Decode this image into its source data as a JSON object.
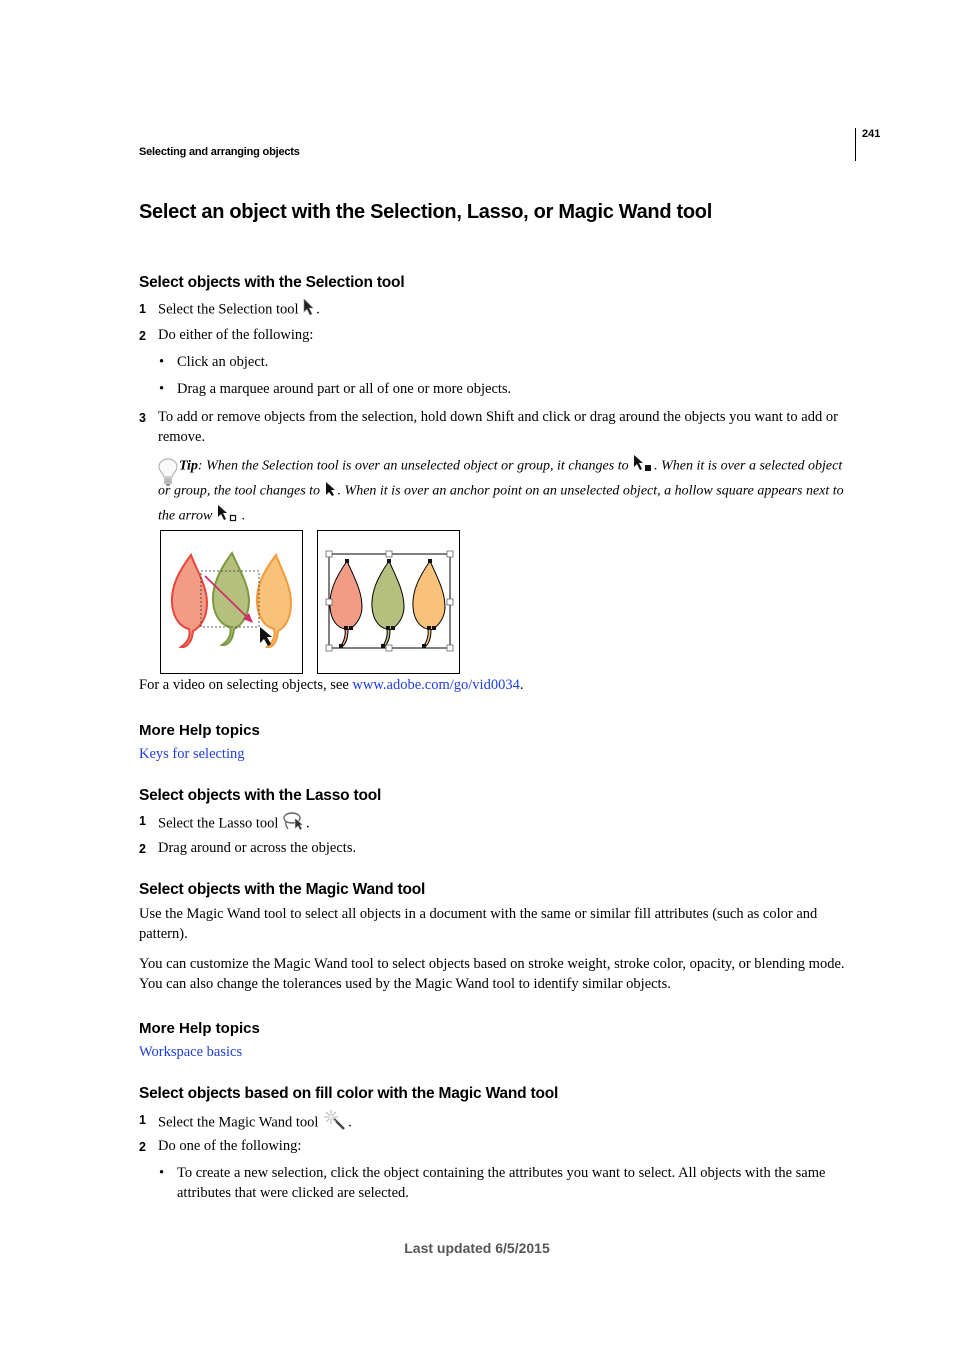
{
  "header": {
    "running_head": "Selecting and arranging objects",
    "page_number": "241"
  },
  "title": "Select an object with the Selection, Lasso, or Magic Wand tool",
  "selection_section": {
    "heading": "Select objects with the Selection tool",
    "steps": [
      {
        "num": "1",
        "text": "Select the Selection tool",
        "icon": "selection-arrow-icon",
        "suffix": "."
      },
      {
        "num": "2",
        "text": "Do either of the following:"
      },
      {
        "num": "3",
        "text": "To add or remove objects from the selection, hold down Shift and click or drag around the objects you want to add or remove."
      }
    ],
    "bullets": [
      "Click an object.",
      "Drag a marquee around part or all of one or more objects."
    ],
    "tip": {
      "icon": "lightbulb-icon",
      "label": "Tip",
      "part1": ": When the Selection tool is over an unselected object or group, it changes to ",
      "part2": ". When it is over a selected object or group, the tool changes to ",
      "part3": ". When it is over an anchor point on an unselected object, a hollow square appears next to the arrow ",
      "part4": "."
    },
    "figure": {
      "left_panel": "marquee-drag-over-leaves",
      "right_panel": "leaves-selected-bounding-box",
      "leaf_colors": [
        "#f29b85",
        "#b5c07f",
        "#f9c27a"
      ],
      "leaf_strokes": [
        "#e8463d",
        "#7a9a3e",
        "#f39a3a"
      ],
      "arrow_color": "#d0306a"
    },
    "video_text": "For a video on selecting objects, see ",
    "video_link": "www.adobe.com/go/vid0034",
    "video_suffix": ".",
    "more_help_heading": "More Help topics",
    "more_help_link": "Keys for selecting"
  },
  "lasso_section": {
    "heading": "Select objects with the Lasso tool",
    "steps": [
      {
        "num": "1",
        "text": "Select the Lasso tool",
        "icon": "lasso-tool-icon",
        "suffix": "."
      },
      {
        "num": "2",
        "text": "Drag around or across the objects."
      }
    ]
  },
  "magic_wand_section": {
    "heading": "Select objects with the Magic Wand tool",
    "para1": "Use the Magic Wand tool to select all objects in a document with the same or similar fill attributes (such as color and pattern).",
    "para2": "You can customize the Magic Wand tool to select objects based on stroke weight, stroke color, opacity, or blending mode. You can also change the tolerances used by the Magic Wand tool to identify similar objects.",
    "more_help_heading": "More Help topics",
    "more_help_link": "Workspace basics"
  },
  "fill_color_section": {
    "heading": "Select objects based on fill color with the Magic Wand tool",
    "steps": [
      {
        "num": "1",
        "text": "Select the Magic Wand tool",
        "icon": "magic-wand-icon",
        "suffix": "."
      },
      {
        "num": "2",
        "text": "Do one of the following:"
      }
    ],
    "bullets": [
      "To create a new selection, click the object containing the attributes you want to select. All objects with the same attributes that were clicked are selected."
    ]
  },
  "footer": {
    "last_updated": "Last updated 6/5/2015"
  }
}
